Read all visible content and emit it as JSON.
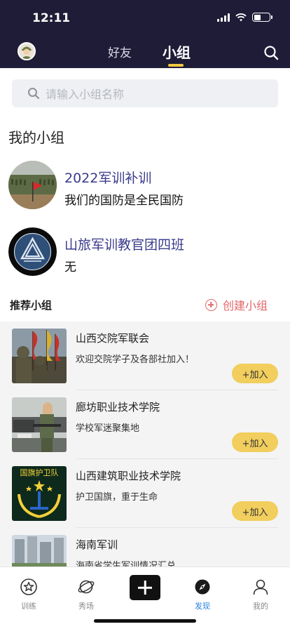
{
  "status": {
    "time": "12:11"
  },
  "header": {
    "tabs": [
      {
        "label": "好友",
        "active": false
      },
      {
        "label": "小组",
        "active": true
      }
    ],
    "accent_color": "#f1c842",
    "background_color": "#1f1c37"
  },
  "search": {
    "placeholder": "请输入小组名称"
  },
  "my_groups": {
    "title": "我的小组",
    "items": [
      {
        "name": "2022军训补训",
        "description": "我们的国防是全民国防"
      },
      {
        "name": "山旅军训教官团四班",
        "description": "无"
      }
    ]
  },
  "recommended": {
    "title": "推荐小组",
    "create_label": "创建小组",
    "join_label": "+加入",
    "items": [
      {
        "name": "山西交院军联会",
        "description": "欢迎交院学子及各部社加入！"
      },
      {
        "name": "廊坊职业技术学院",
        "description": "学校军迷聚集地"
      },
      {
        "name": "山西建筑职业技术学院",
        "description": "护卫国旗，重于生命",
        "thumb_text": "国旗护卫队"
      },
      {
        "name": "海南军训",
        "description": "海南省学生军训情况汇总"
      }
    ]
  },
  "bottom_nav": {
    "items": [
      {
        "label": "训练",
        "icon": "star-icon",
        "active": false
      },
      {
        "label": "秀场",
        "icon": "planet-icon",
        "active": false
      },
      {
        "label": "",
        "icon": "plus-icon",
        "active": false
      },
      {
        "label": "发现",
        "icon": "compass-icon",
        "active": true
      },
      {
        "label": "我的",
        "icon": "person-icon",
        "active": false
      }
    ],
    "active_color": "#2980e0"
  }
}
